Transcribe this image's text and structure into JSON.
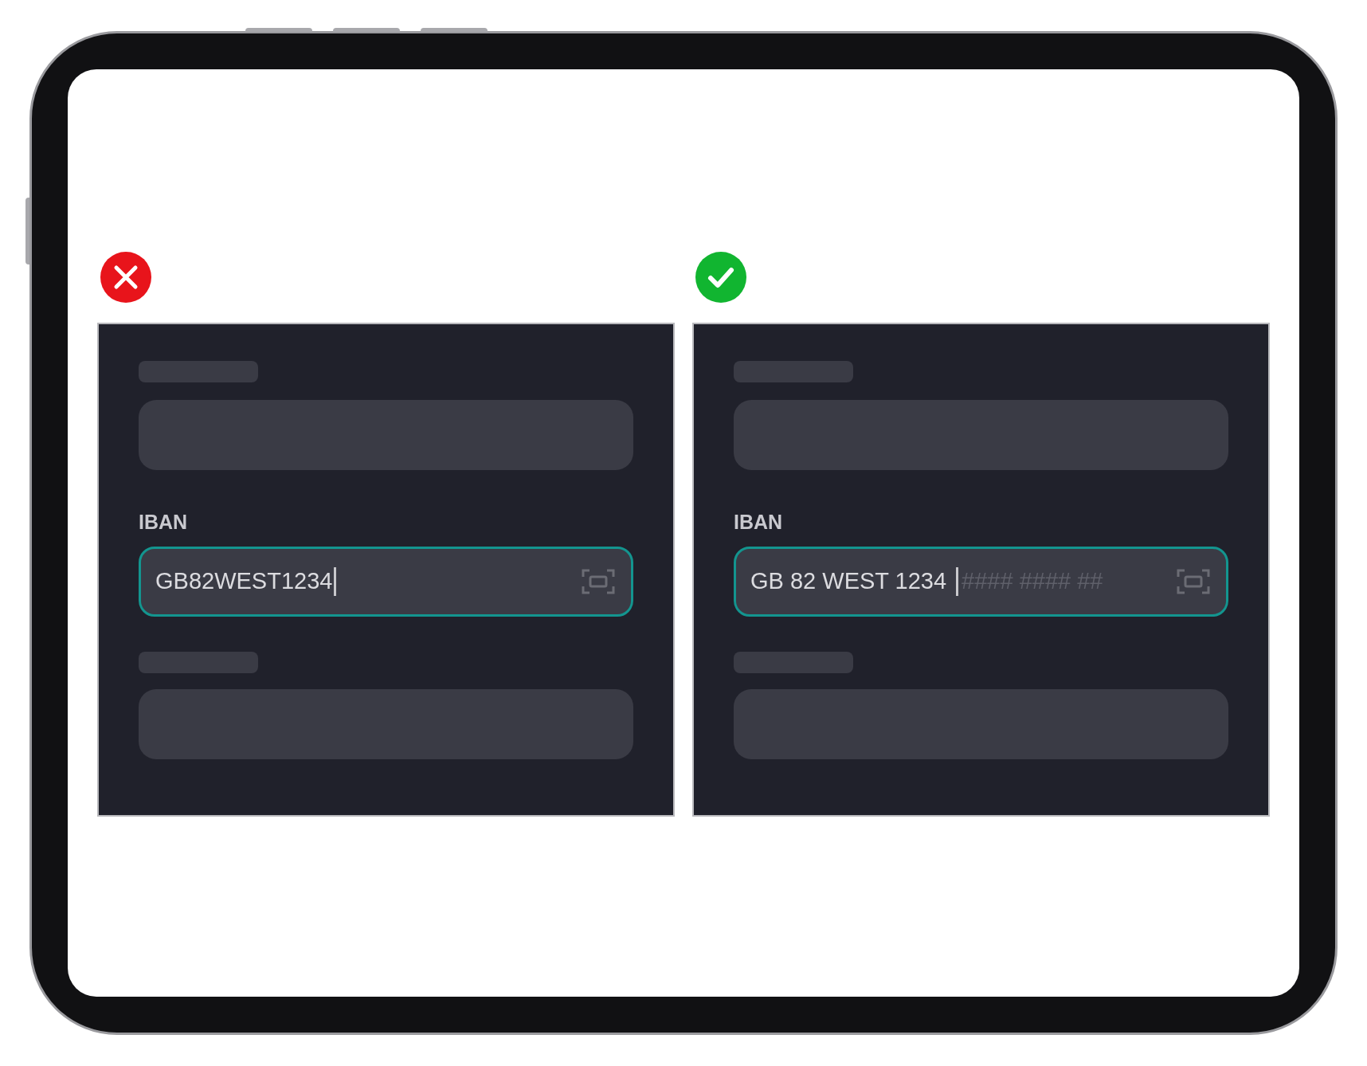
{
  "panels": [
    {
      "kind": "wrong",
      "field": {
        "label": "IBAN",
        "value": "GB82WEST1234"
      }
    },
    {
      "kind": "right",
      "field": {
        "label": "IBAN",
        "value": "GB 82 WEST 1234",
        "mask": "#### #### ##"
      }
    }
  ]
}
